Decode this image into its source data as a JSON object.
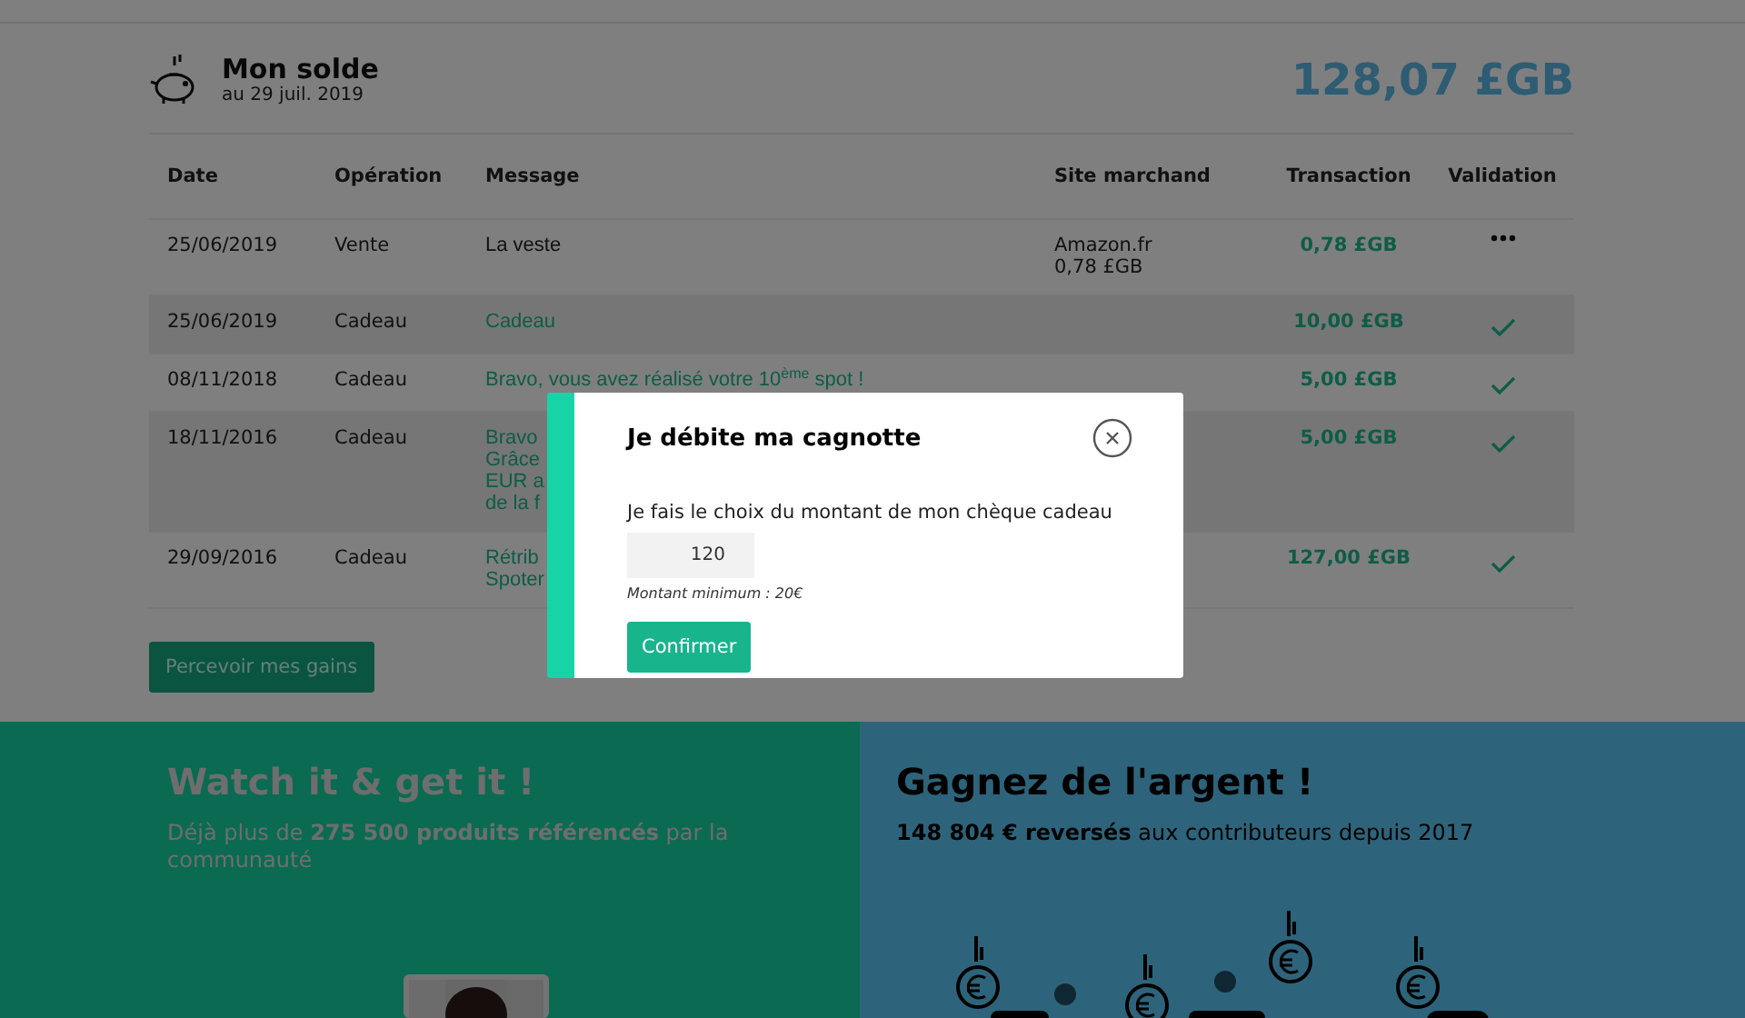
{
  "balance": {
    "title": "Mon solde",
    "date": "au 29 juil. 2019",
    "amount": "128,07 £GB"
  },
  "table": {
    "columns": [
      "Date",
      "Opération",
      "Message",
      "Site marchand",
      "Transaction",
      "Validation"
    ],
    "rows": [
      {
        "date": "25/06/2019",
        "operation": "Vente",
        "message": [
          "La veste"
        ],
        "highlighted": false,
        "merchant": [
          "Amazon.fr",
          "0,78 £GB"
        ],
        "transaction": "0,78 £GB",
        "validated": false
      },
      {
        "date": "25/06/2019",
        "operation": "Cadeau",
        "message": [
          "Cadeau"
        ],
        "highlighted": true,
        "merchant": [],
        "transaction": "10,00 £GB",
        "validated": true
      },
      {
        "date": "08/11/2018",
        "operation": "Cadeau",
        "message": [
          "Bravo, vous avez réalisé votre 10$^{ème}$ spot !"
        ],
        "highlighted": true,
        "merchant": [],
        "transaction": "5,00 £GB",
        "validated": true
      },
      {
        "date": "18/11/2016",
        "operation": "Cadeau",
        "message": [
          "Bravo",
          "Grâce",
          "EUR a",
          "de la f"
        ],
        "highlighted": true,
        "merchant": [],
        "transaction": "5,00 £GB",
        "validated": true
      },
      {
        "date": "29/09/2016",
        "operation": "Cadeau",
        "message": [
          "Rétrib",
          "Spoter"
        ],
        "highlighted": true,
        "merchant": [],
        "transaction": "127,00 £GB",
        "validated": true
      }
    ]
  },
  "collect_button": "Percevoir mes gains",
  "promos": [
    {
      "kind": "products",
      "title": "Watch it & get it !",
      "text": "Déjà plus de **275 500 produits référencés** par la communauté"
    },
    {
      "kind": "earnings",
      "title": "Gagnez de l'argent !",
      "text": "**148 804 € reversés** aux contributeurs depuis 2017"
    }
  ],
  "modal": {
    "title": "Je débite ma cagnotte",
    "label": "Je fais le choix du montant de mon chèque cadeau",
    "value": "120",
    "hint": "Montant minimum : 20€",
    "button": "Confirmer"
  }
}
